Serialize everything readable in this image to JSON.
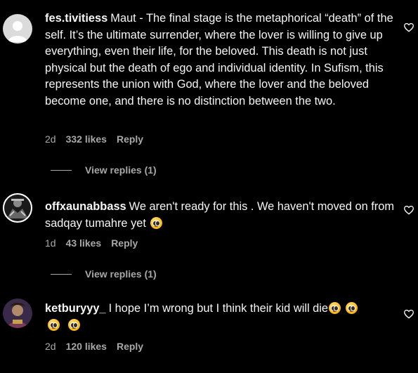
{
  "comments": [
    {
      "username": "fes.tivitiess",
      "text": "Maut - The final stage is the metaphorical “death” of the self. It’s the ultimate surrender, where the lover is willing to give up everything, even their life, for the beloved. This death is not just physical but the death of ego and individual identity. In Sufism, this represents the union with God, where the lover and the beloved become one, and there is no distinction between the two.",
      "age": "2d",
      "likes": "332 likes",
      "reply": "Reply",
      "view_replies": "View replies (1)"
    },
    {
      "username": "offxaunabbass",
      "text": "We aren't ready for this . We haven't moved on from sadqay tumahre yet",
      "age": "1d",
      "likes": "43 likes",
      "reply": "Reply",
      "view_replies": "View replies (1)"
    },
    {
      "username": "ketburyyy_",
      "text": "I hope I’m wrong but I think their kid will die",
      "age": "2d",
      "likes": "120 likes",
      "reply": "Reply"
    }
  ],
  "icons": {
    "like": "heart-icon",
    "emoji": "pleading-face-emoji"
  }
}
